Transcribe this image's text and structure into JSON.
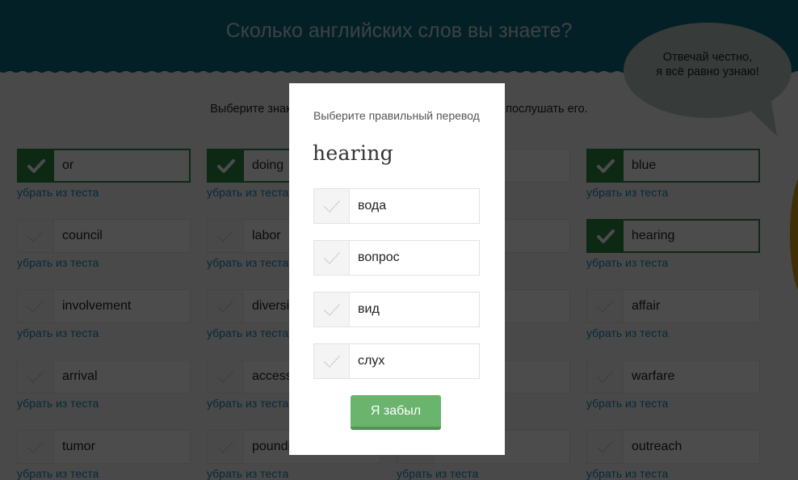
{
  "header": {
    "title": "Сколько английских слов вы знаете?"
  },
  "bubble": {
    "line1": "Отвечай честно,",
    "line2": "я всё равно узнаю!"
  },
  "instruction": "Выберите знакомые слова. Нажмите на слово, чтобы послушать его.",
  "remove_label": "убрать из теста",
  "words": [
    {
      "text": "or",
      "checked": true
    },
    {
      "text": "doing",
      "checked": true
    },
    {
      "text": "",
      "checked": false
    },
    {
      "text": "blue",
      "checked": true
    },
    {
      "text": "council",
      "checked": false
    },
    {
      "text": "labor",
      "checked": false
    },
    {
      "text": "",
      "checked": false
    },
    {
      "text": "hearing",
      "checked": true
    },
    {
      "text": "involvement",
      "checked": false
    },
    {
      "text": "diversity",
      "checked": false
    },
    {
      "text": "",
      "checked": false
    },
    {
      "text": "affair",
      "checked": false
    },
    {
      "text": "arrival",
      "checked": false
    },
    {
      "text": "access",
      "checked": false
    },
    {
      "text": "",
      "checked": false
    },
    {
      "text": "warfare",
      "checked": false
    },
    {
      "text": "tumor",
      "checked": false
    },
    {
      "text": "pounding",
      "checked": false
    },
    {
      "text": "",
      "checked": false
    },
    {
      "text": "outreach",
      "checked": false
    }
  ],
  "modal": {
    "prompt": "Выберите правильный перевод",
    "word": "hearing",
    "options": [
      "вода",
      "вопрос",
      "вид",
      "слух"
    ],
    "forgot_label": "Я забыл"
  },
  "colors": {
    "header": "#0a6b80",
    "checked_green": "#2e8a45",
    "link_blue": "#1b87b8",
    "button_green": "#6ab46d"
  }
}
